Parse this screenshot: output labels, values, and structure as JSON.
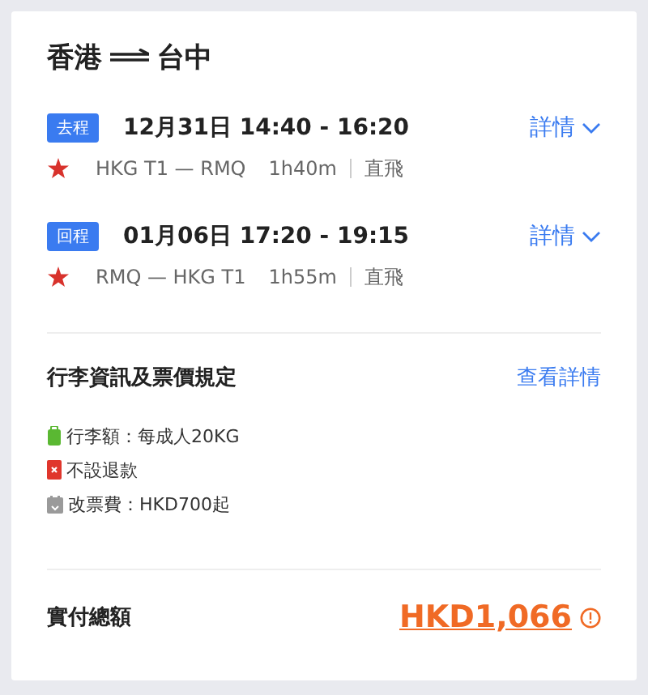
{
  "route": {
    "from": "香港",
    "to": "台中"
  },
  "segments": [
    {
      "tag": "去程",
      "datetime": "12月31日 14:40 - 16:20",
      "airports": "HKG T1 — RMQ",
      "duration": "1h40m",
      "stops": "直飛",
      "details_link": "詳情"
    },
    {
      "tag": "回程",
      "datetime": "01月06日 17:20 - 19:15",
      "airports": "RMQ — HKG T1",
      "duration": "1h55m",
      "stops": "直飛",
      "details_link": "詳情"
    }
  ],
  "baggage": {
    "title": "行李資訊及票價規定",
    "link": "查看詳情",
    "rules": [
      {
        "kind": "baggage",
        "text": "行李額：每成人20KG"
      },
      {
        "kind": "refund",
        "text": "不設退款"
      },
      {
        "kind": "change",
        "text": "改票費：HKD700起"
      }
    ]
  },
  "total": {
    "label": "實付總額",
    "amount": "HKD1,066"
  }
}
